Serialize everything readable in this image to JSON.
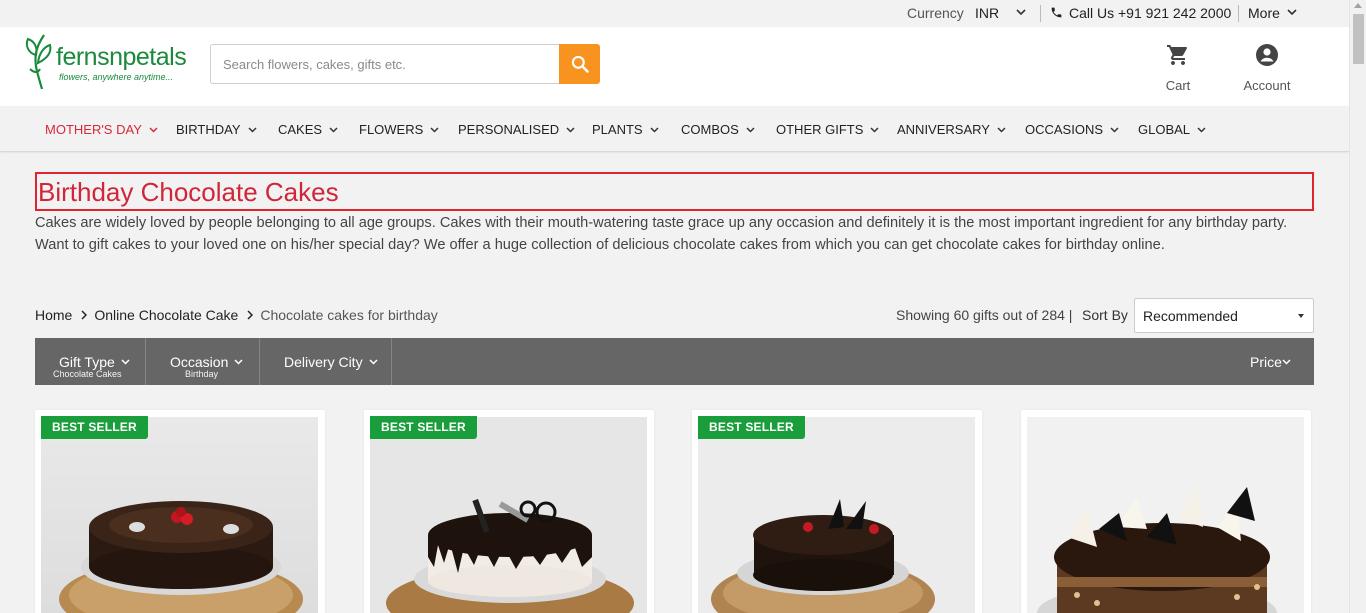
{
  "topbar": {
    "currency_label": "Currency",
    "currency_value": "INR",
    "call_text": "Call Us +91 921 242 2000",
    "more_label": "More"
  },
  "header": {
    "logo_brand": "fernsnpetals",
    "logo_tagline": "flowers, anywhere anytime...",
    "search_placeholder": "Search flowers, cakes, gifts etc.",
    "cart_label": "Cart",
    "account_label": "Account",
    "brand_color": "#1a8a3b",
    "search_button_color": "#f7931e"
  },
  "nav": {
    "items": [
      {
        "label": "MOTHER'S DAY",
        "active": true
      },
      {
        "label": "BIRTHDAY"
      },
      {
        "label": "CAKES"
      },
      {
        "label": "FLOWERS"
      },
      {
        "label": "PERSONALISED"
      },
      {
        "label": "PLANTS"
      },
      {
        "label": "COMBOS"
      },
      {
        "label": "OTHER GIFTS"
      },
      {
        "label": "ANNIVERSARY"
      },
      {
        "label": "OCCASIONS"
      },
      {
        "label": "GLOBAL"
      }
    ],
    "active_color": "#d9283b"
  },
  "page": {
    "title": "Birthday Chocolate Cakes",
    "description": "Cakes are widely loved by people belonging to all age groups. Cakes with their mouth-watering taste grace up any occasion and definitely it is the most important ingredient for any birthday party. Want to gift cakes to your loved one on his/her special day? We offer a huge collection of delicious chocolate cakes from which you can get chocolate cakes for birthday online."
  },
  "breadcrumb": {
    "items": [
      "Home",
      "Online Chocolate Cake",
      "Chocolate cakes for birthday"
    ]
  },
  "listing": {
    "showing_text": "Showing 60 gifts out of 284 |",
    "sort_label": "Sort By",
    "sort_value": "Recommended"
  },
  "filters": {
    "items": [
      {
        "label": "Gift Type",
        "sub": "Chocolate Cakes"
      },
      {
        "label": "Occasion",
        "sub": "Birthday"
      },
      {
        "label": "Delivery City",
        "sub": ""
      }
    ],
    "price_label": "Price"
  },
  "products": [
    {
      "badge": "BEST SELLER",
      "cake": "truffle-cherry"
    },
    {
      "badge": "BEST SELLER",
      "cake": "drip-cake"
    },
    {
      "badge": "BEST SELLER",
      "cake": "truffle-hearts"
    },
    {
      "badge": "",
      "cake": "white-chocolate-shards"
    }
  ]
}
